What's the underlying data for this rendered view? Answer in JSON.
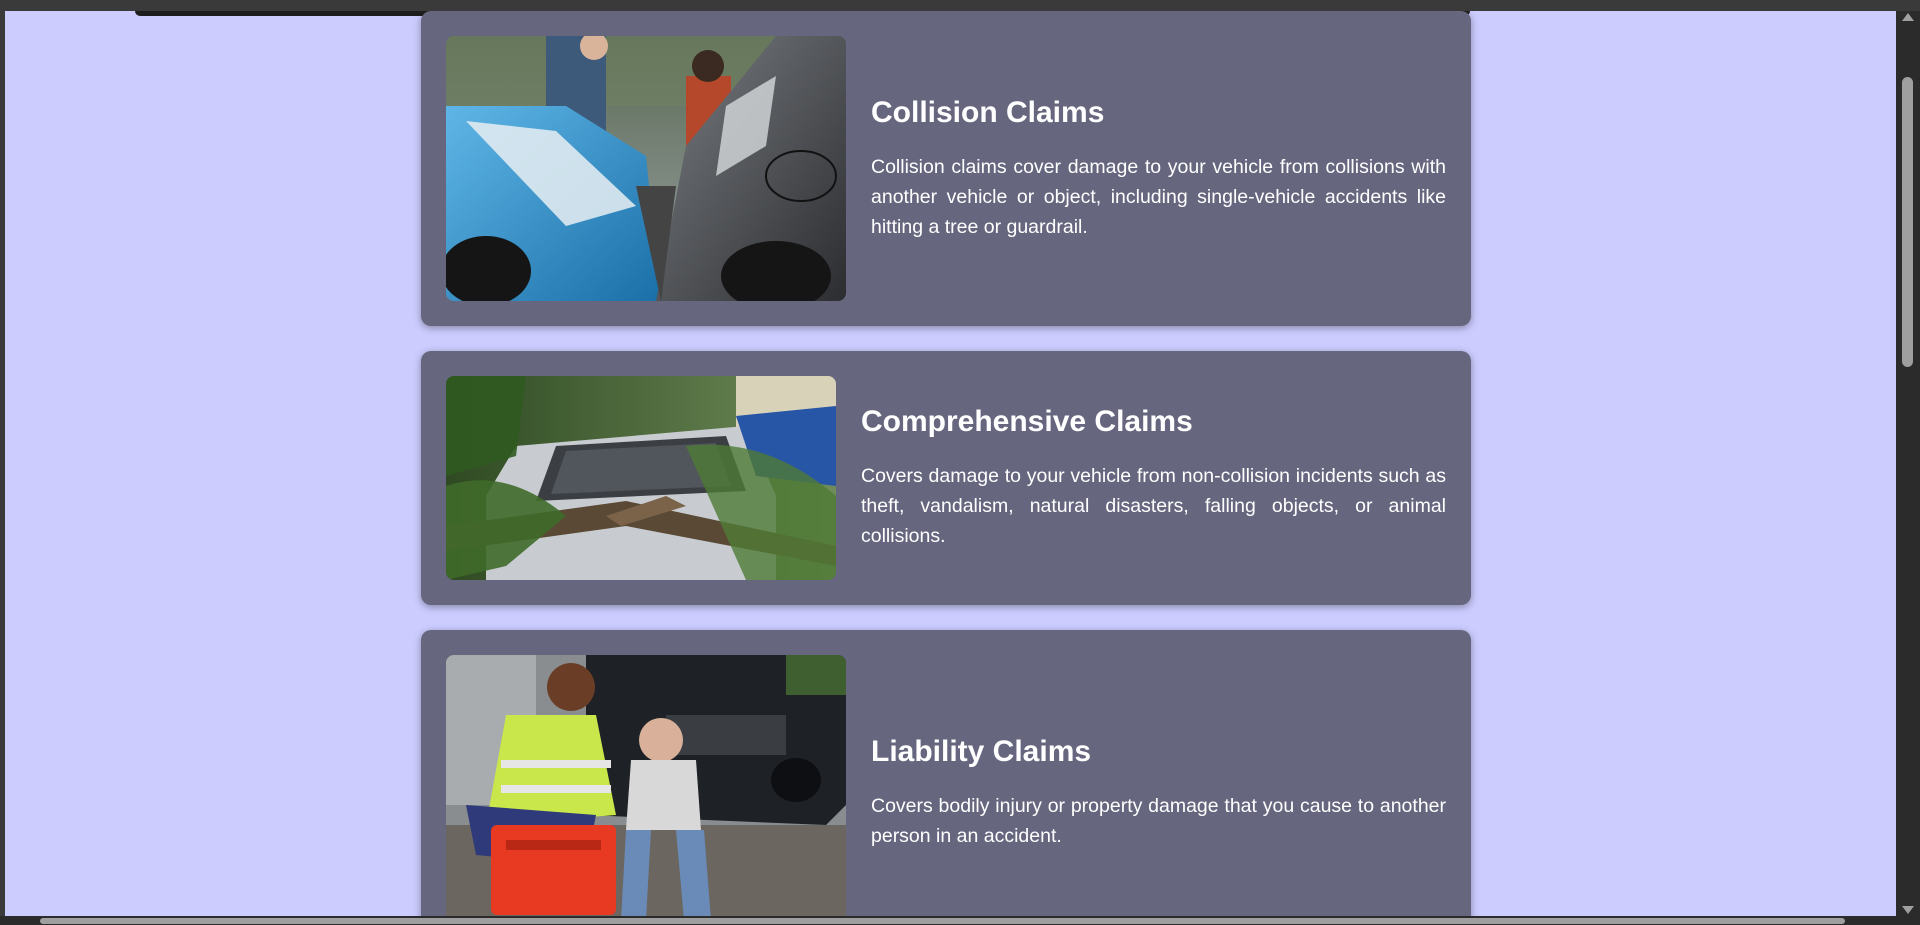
{
  "cards": [
    {
      "title": "Collision Claims",
      "description": "Collision claims cover damage to your vehicle from collisions with another vehicle or object, including single-vehicle accidents like hitting a tree or guardrail.",
      "image": "car-collision-photo"
    },
    {
      "title": "Comprehensive Claims",
      "description": "Covers damage to your vehicle from non-collision incidents such as theft, vandalism, natural disasters, falling objects, or animal collisions.",
      "image": "fallen-tree-on-car-photo"
    },
    {
      "title": "Liability Claims",
      "description": "Covers bodily injury or property damage that you cause to another person in an accident.",
      "image": "paramedic-injury-photo"
    }
  ],
  "colors": {
    "page_background": "#ccccff",
    "card_background": "#66667f",
    "card_text": "#ffffff"
  }
}
